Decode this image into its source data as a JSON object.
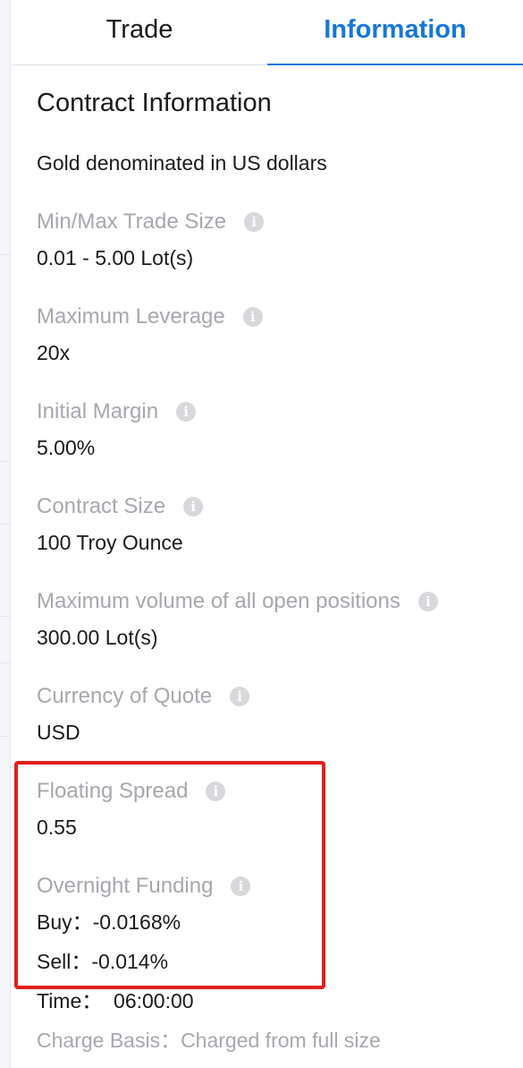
{
  "tabs": [
    {
      "label": "Trade",
      "active": false
    },
    {
      "label": "Information",
      "active": true
    }
  ],
  "section_title": "Contract Information",
  "description": "Gold denominated in US dollars",
  "items": [
    {
      "label": "Min/Max Trade Size",
      "value": "0.01 - 5.00 Lot(s)"
    },
    {
      "label": "Maximum Leverage",
      "value": "20x"
    },
    {
      "label": "Initial Margin",
      "value": "5.00%"
    },
    {
      "label": "Contract Size",
      "value": "100 Troy Ounce"
    },
    {
      "label": "Maximum volume of all open positions",
      "value": "300.00 Lot(s)"
    },
    {
      "label": "Currency of Quote",
      "value": "USD"
    },
    {
      "label": "Floating Spread",
      "value": "0.55"
    }
  ],
  "overnight": {
    "label": "Overnight Funding",
    "buy": "Buy：-0.0168%",
    "sell": "Sell：-0.014%",
    "time": "Time：  06:00:00",
    "charge_basis": "Charge Basis：Charged from full size"
  },
  "info_icon": "info-circle-icon",
  "colors": {
    "accent": "#1677d9",
    "highlight": "#e0201b",
    "label_gray": "#a5a8ad"
  }
}
